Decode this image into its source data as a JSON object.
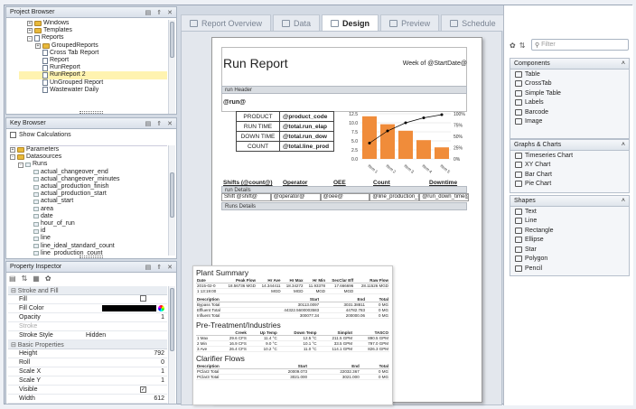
{
  "project_browser": {
    "title": "Project Browser",
    "items": [
      {
        "label": "Windows",
        "indent": 1,
        "kind": "folder",
        "exp": "+"
      },
      {
        "label": "Templates",
        "indent": 1,
        "kind": "folder",
        "exp": "+"
      },
      {
        "label": "Reports",
        "indent": 1,
        "kind": "doc",
        "exp": "-"
      },
      {
        "label": "GroupedReports",
        "indent": 2,
        "kind": "folder",
        "exp": "+"
      },
      {
        "label": "Cross Tab Report",
        "indent": 2,
        "kind": "doc",
        "exp": ""
      },
      {
        "label": "Report",
        "indent": 2,
        "kind": "doc",
        "exp": ""
      },
      {
        "label": "RunReport",
        "indent": 2,
        "kind": "doc",
        "exp": ""
      },
      {
        "label": "RunReport 2",
        "indent": 2,
        "kind": "doc",
        "exp": "",
        "selected": true
      },
      {
        "label": "UnGrouped Report",
        "indent": 2,
        "kind": "doc",
        "exp": ""
      },
      {
        "label": "Wastewater Daily",
        "indent": 2,
        "kind": "doc",
        "exp": ""
      }
    ]
  },
  "key_browser": {
    "title": "Key Browser",
    "show_calc_label": "Show Calculations",
    "items": [
      {
        "label": "Parameters",
        "indent": 0,
        "kind": "folder",
        "exp": "+"
      },
      {
        "label": "Datasources",
        "indent": 0,
        "kind": "folder",
        "exp": "-"
      },
      {
        "label": "Runs",
        "indent": 1,
        "kind": "fld",
        "exp": "-"
      },
      {
        "label": "actual_changeover_end",
        "indent": 2,
        "kind": "fld",
        "exp": ""
      },
      {
        "label": "actual_changeover_minutes",
        "indent": 2,
        "kind": "fld",
        "exp": ""
      },
      {
        "label": "actual_production_finish",
        "indent": 2,
        "kind": "fld",
        "exp": ""
      },
      {
        "label": "actual_production_start",
        "indent": 2,
        "kind": "fld",
        "exp": ""
      },
      {
        "label": "actual_start",
        "indent": 2,
        "kind": "fld",
        "exp": ""
      },
      {
        "label": "area",
        "indent": 2,
        "kind": "fld",
        "exp": ""
      },
      {
        "label": "date",
        "indent": 2,
        "kind": "fld",
        "exp": ""
      },
      {
        "label": "hour_of_run",
        "indent": 2,
        "kind": "fld",
        "exp": ""
      },
      {
        "label": "id",
        "indent": 2,
        "kind": "fld",
        "exp": ""
      },
      {
        "label": "line",
        "indent": 2,
        "kind": "fld",
        "exp": ""
      },
      {
        "label": "line_ideal_standard_count",
        "indent": 2,
        "kind": "fld",
        "exp": ""
      },
      {
        "label": "line_production_count",
        "indent": 2,
        "kind": "fld",
        "exp": ""
      }
    ]
  },
  "property_inspector": {
    "title": "Property Inspector",
    "sections": [
      {
        "name": "Stroke and Fill",
        "rows": [
          {
            "k": "Fill",
            "v": "",
            "type": "check"
          },
          {
            "k": "Fill Color",
            "v": "",
            "type": "color"
          },
          {
            "k": "Opacity",
            "v": "1"
          },
          {
            "k": "Stroke",
            "v": "",
            "dim": true
          },
          {
            "k": "Stroke Style",
            "v": "Hidden",
            "align": "left"
          }
        ]
      },
      {
        "name": "Basic Properties",
        "rows": [
          {
            "k": "Height",
            "v": "792"
          },
          {
            "k": "Roll",
            "v": "0"
          },
          {
            "k": "Scale X",
            "v": "1"
          },
          {
            "k": "Scale Y",
            "v": "1"
          },
          {
            "k": "Visible",
            "v": "",
            "type": "checked"
          },
          {
            "k": "Width",
            "v": "612"
          }
        ]
      }
    ]
  },
  "tabs": [
    "Report Overview",
    "Data",
    "Design",
    "Preview",
    "Schedule"
  ],
  "active_tab": "Design",
  "report": {
    "title": "Run Report",
    "week": "Week of @StartDate@",
    "run_header": "run Header",
    "run_token": "@run@",
    "kv": [
      [
        "PRODUCT",
        "@product_code"
      ],
      [
        "RUN TIME",
        "@total.run_elap"
      ],
      [
        "DOWN TIME",
        "@total.run_dow"
      ],
      [
        "COUNT",
        "@total.line_prod"
      ]
    ],
    "headers": [
      "Shifts (@count@)",
      "Operator",
      "OEE",
      "Count",
      "Downtime"
    ],
    "run_details": "run Details",
    "row": [
      "Shift @shift@",
      "@operator@",
      "@oee@",
      "@line_production_count@ min",
      "@run_down_time@"
    ],
    "runs_details": "Runs Details"
  },
  "chart_data": {
    "type": "bar",
    "categories": [
      "Item 1",
      "Item 2",
      "Item 3",
      "Item 4",
      "Item 5"
    ],
    "values": [
      11.8,
      9.6,
      7.8,
      5.2,
      3.2
    ],
    "line_values": [
      35,
      62,
      80,
      91,
      98
    ],
    "ylim": [
      0,
      12.5
    ],
    "y_ticks": [
      "12.5",
      "10.0",
      "7.5",
      "5.0",
      "2.5",
      "0.0"
    ],
    "y2_ticks": [
      "100%",
      "75%",
      "50%",
      "25%",
      "0%"
    ],
    "bar_color": "#f08c3a"
  },
  "summary": {
    "title": "Plant Summary",
    "cols": [
      "Date",
      "Peak Flow",
      "Hr Ave",
      "Hr Max",
      "Hr Min",
      "SecClar Eff",
      "Raw Flow"
    ],
    "row": [
      "2015-02-0",
      "18.56736 MGD",
      "14.344411",
      "18.34272",
      "11.93378",
      "17.666696",
      "28.11526 MGD"
    ],
    "row2": [
      "1 13:19:00",
      "",
      "MGD",
      "MGD",
      "MGD",
      "MGD",
      ""
    ],
    "desc_cols": [
      "Description",
      "Start",
      "End",
      "Total"
    ],
    "desc_rows": [
      [
        "Bypass Total",
        "30113.0097",
        "3031.38811",
        "0 MG"
      ],
      [
        "Effluent Total",
        "44322.5600003583",
        "44782.783",
        "0 MG"
      ],
      [
        "Influent Total",
        "300077.34",
        "200000.06",
        "0 MG"
      ]
    ],
    "pt_title": "Pre-Treatment/Industries",
    "pt_cols": [
      "",
      "Creek",
      "Up Temp",
      "Down Temp",
      "Simplot",
      "TASCO"
    ],
    "pt_rows": [
      [
        "1 Max",
        "29.6 CFS",
        "11.4 °C",
        "12.5 °C",
        "211.5 GPM",
        "890.5 GPM"
      ],
      [
        "2 Min",
        "16.9 CFS",
        "9.0 °C",
        "10.1 °C",
        "33.5 GPM",
        "797.0 GPM"
      ],
      [
        "3 Ave",
        "26.4 CFS",
        "10.2 °C",
        "11.0 °C",
        "114.1 GPM",
        "826.3 GPM"
      ]
    ],
    "cf_title": "Clarifier Flows",
    "cf_rows": [
      [
        "PClar2 Total",
        "20009.073",
        "22032.367",
        "0 MG"
      ],
      [
        "PClar3 Total",
        "3021.000",
        "3021.000",
        "0 MG"
      ]
    ]
  },
  "right_panel": {
    "filter_placeholder": "Filter",
    "components_title": "Components",
    "components": [
      "Table",
      "CrossTab",
      "Simple Table",
      "Labels",
      "Barcode",
      "Image"
    ],
    "charts_title": "Graphs & Charts",
    "charts": [
      "Timeseries Chart",
      "XY Chart",
      "Bar Chart",
      "Pie Chart"
    ],
    "shapes_title": "Shapes",
    "shapes": [
      "Text",
      "Line",
      "Rectangle",
      "Ellipse",
      "Star",
      "Polygon",
      "Pencil"
    ]
  }
}
